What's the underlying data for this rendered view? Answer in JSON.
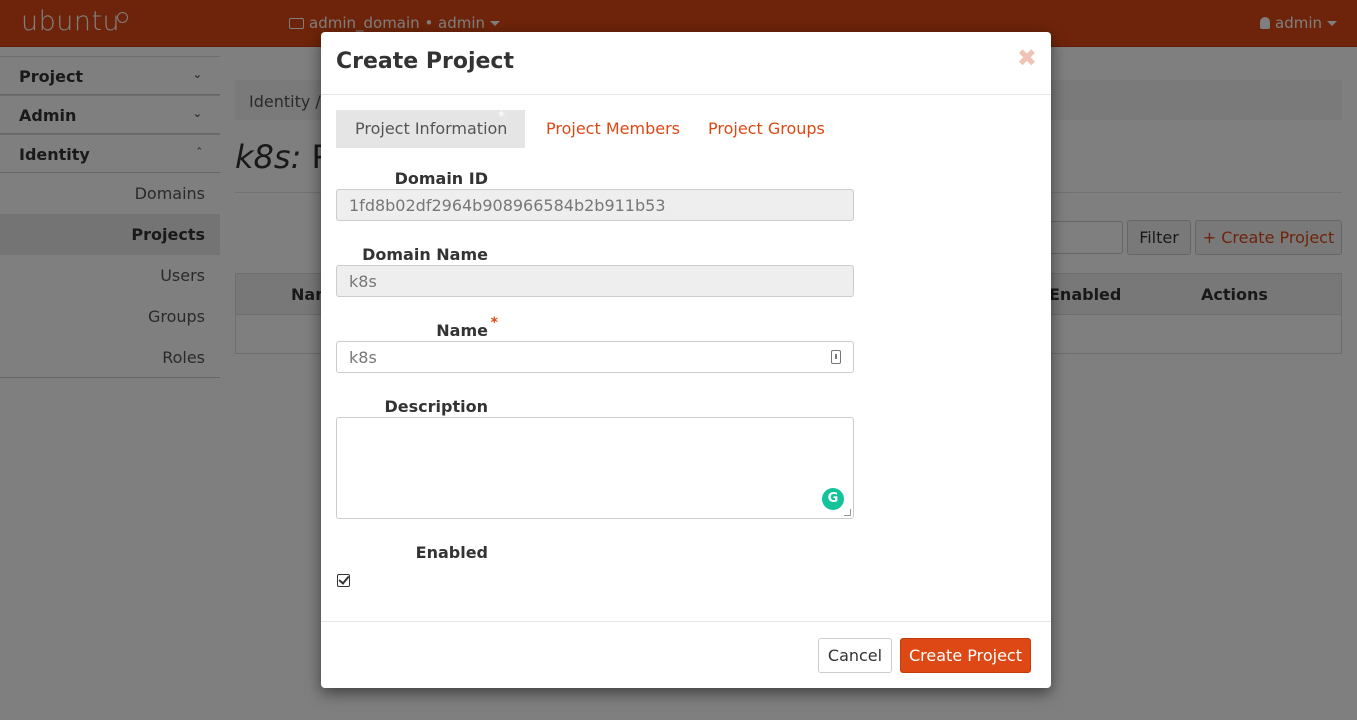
{
  "topbar": {
    "logo": "ubuntu",
    "context": "admin_domain • admin",
    "user": "admin",
    "accent": "#dd4814"
  },
  "sidebar": {
    "groups": [
      {
        "label": "Project",
        "chevron": "chevron-down-icon"
      },
      {
        "label": "Admin",
        "chevron": "chevron-down-icon"
      },
      {
        "label": "Identity",
        "chevron": "chevron-up-icon"
      }
    ],
    "items": [
      {
        "label": "Domains"
      },
      {
        "label": "Projects",
        "active": true
      },
      {
        "label": "Users"
      },
      {
        "label": "Groups"
      },
      {
        "label": "Roles"
      }
    ]
  },
  "main": {
    "breadcrumb": "Identity /",
    "title_domain": "k8s:",
    "title_rest": "P",
    "filter_label": "Filter",
    "create_label": "Create Project",
    "table_headers": [
      "Nam",
      "Enabled",
      "Actions"
    ]
  },
  "modal": {
    "title": "Create Project",
    "close": "✖",
    "tabs": [
      "Project Information",
      "Project Members",
      "Project Groups"
    ],
    "domain_id_label": "Domain ID",
    "domain_id_value": "1fd8b02df2964b908966584b2b911b53",
    "domain_name_label": "Domain Name",
    "domain_name_value": "k8s",
    "name_label": "Name",
    "name_required": "*",
    "name_value": "k8s",
    "description_label": "Description",
    "description_value": "",
    "enabled_label": "Enabled",
    "enabled": true,
    "cancel_label": "Cancel",
    "submit_label": "Create Project"
  }
}
